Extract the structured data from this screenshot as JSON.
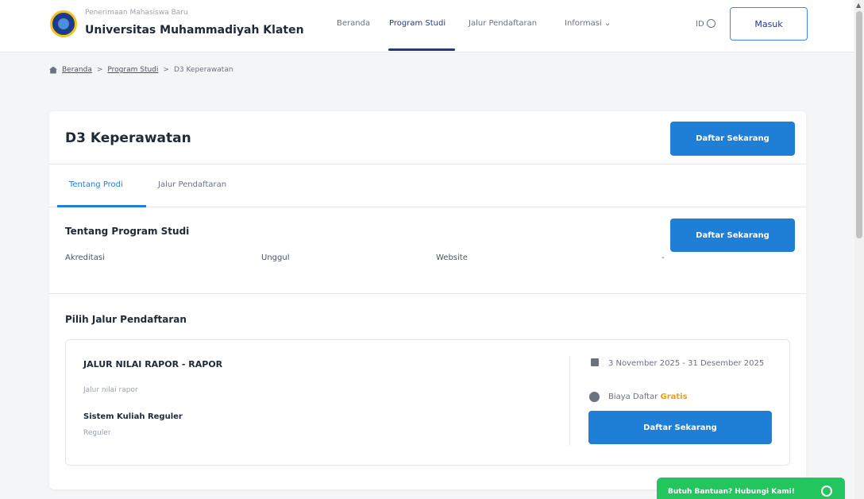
{
  "header": {
    "brand_subtitle": "Penerimaan Mahasiswa Baru",
    "brand_title": "Universitas Muhammadiyah Klaten",
    "nav": [
      {
        "label": "Beranda"
      },
      {
        "label": "Program Studi"
      },
      {
        "label": "Jalur Pendaftaran"
      },
      {
        "label": "Informasi ⌄"
      }
    ],
    "lang": "ID",
    "login_label": "Masuk",
    "logo_icon": "university-logo",
    "globe_icon": "globe-icon"
  },
  "breadcrumb": {
    "home_icon": "home-icon",
    "items": [
      "Beranda",
      "Program Studi",
      "D3 Keperawatan"
    ],
    "separator": ">"
  },
  "card": {
    "title": "D3 Keperawatan",
    "register_label": "Daftar Sekarang",
    "tabs": [
      {
        "label": "Tentang Prodi"
      },
      {
        "label": "Jalur Pendaftaran"
      }
    ],
    "about": {
      "title": "Tentang Program Studi",
      "register_label": "Daftar Sekarang",
      "akreditasi_label": "Akreditasi",
      "akreditasi_value": "Unggul",
      "website_label": "Website",
      "website_value": "-"
    },
    "jalur": {
      "section_title": "Pilih Jalur Pendaftaran",
      "name": "JALUR NILAI RAPOR - RAPOR",
      "desc": "Jalur nilai rapor",
      "sistem": "Sistem Kuliah Reguler",
      "sistem_value": "Reguler",
      "date": "3 November 2025 - 31 Desember 2025",
      "biaya_label": "Biaya Daftar",
      "biaya_value": "Gratis",
      "register_label": "Daftar Sekarang"
    }
  },
  "whatsapp": {
    "label": "Butuh Bantuan? Hubungi Kami!",
    "icon": "whatsapp-icon"
  },
  "colors": {
    "primary": "#1f7fd6",
    "nav_active": "#1e3a8a",
    "whatsapp": "#22c55e",
    "gratis": "#f59e0b"
  }
}
